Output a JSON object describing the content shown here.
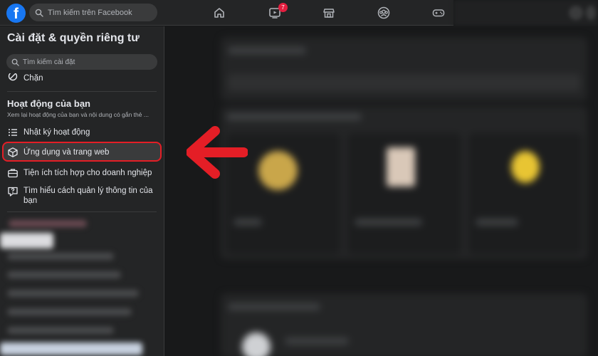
{
  "topbar": {
    "logo_letter": "f",
    "search_placeholder": "Tìm kiếm trên Facebook",
    "nav_icons": [
      "home-icon",
      "video-icon",
      "marketplace-icon",
      "groups-icon",
      "gaming-icon"
    ],
    "video_badge": "7"
  },
  "sidebar": {
    "title": "Cài đặt & quyền riêng tư",
    "search_placeholder": "Tìm kiếm cài đặt",
    "block_label": "Chặn",
    "activity_section": {
      "title": "Hoạt động của bạn",
      "subtitle": "Xem lại hoạt động của bạn và nội dung có gắn thẻ ..."
    },
    "items": [
      {
        "label": "Nhật ký hoạt động",
        "icon": "list-icon"
      },
      {
        "label": "Ứng dụng và trang web",
        "icon": "box-icon",
        "highlighted": true
      },
      {
        "label": "Tiện ích tích hợp cho doanh nghiệp",
        "icon": "briefcase-icon"
      },
      {
        "label": "Tìm hiểu cách quản lý thông tin của bạn",
        "icon": "question-icon"
      }
    ]
  },
  "colors": {
    "accent": "#1877f2",
    "highlight_border": "#e41e26",
    "arrow": "#e41e26",
    "badge": "#e41e3f"
  }
}
